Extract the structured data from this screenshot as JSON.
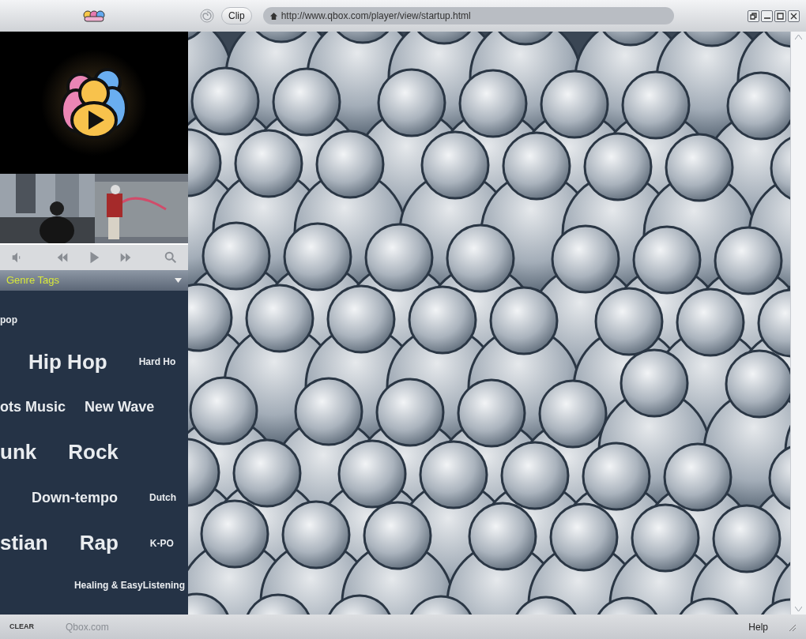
{
  "toolbar": {
    "clip_button": "Clip",
    "address": "http://www.qbox.com/player/view/startup.html"
  },
  "genre_panel": {
    "title": "Genre Tags",
    "rows": [
      [
        {
          "label": "pop",
          "kind": "small"
        }
      ],
      [
        {
          "label": "Hip Hop",
          "kind": "large"
        },
        {
          "label": "Hard Ho",
          "kind": "small"
        }
      ],
      [
        {
          "label": "ots Music",
          "kind": "medium"
        },
        {
          "label": "New Wave",
          "kind": "medium"
        }
      ],
      [
        {
          "label": "unk",
          "kind": "large"
        },
        {
          "label": "Rock",
          "kind": "large"
        }
      ],
      [
        {
          "label": "Down-tempo",
          "kind": "medium"
        },
        {
          "label": "Dutch",
          "kind": "small"
        }
      ],
      [
        {
          "label": "stian",
          "kind": "large"
        },
        {
          "label": "Rap",
          "kind": "large"
        },
        {
          "label": "K-PO",
          "kind": "small"
        }
      ],
      [
        {
          "label": "Healing & EasyListening",
          "kind": "small"
        }
      ]
    ]
  },
  "status_bar": {
    "clear": "CLEAR",
    "site": "Qbox.com",
    "help": "Help"
  }
}
